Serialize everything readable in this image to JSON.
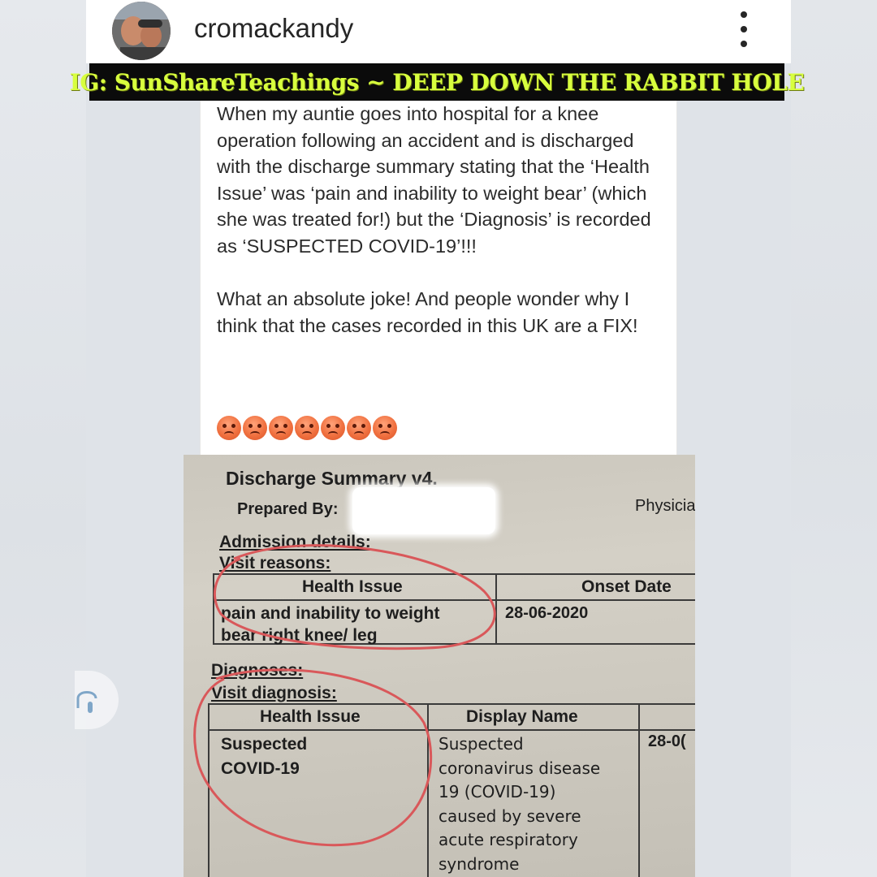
{
  "header": {
    "username": "cromackandy"
  },
  "banner": {
    "text": "IG: SunShareTeachings ~ DEEP DOWN THE RABBIT HOLE"
  },
  "post": {
    "paragraph1": "When my auntie goes into hospital for a knee operation following an accident and is discharged with the discharge summary stating that the ‘Health Issue’ was ‘pain and inability to weight bear’ (which she was treated for!) but the ‘Diagnosis’ is recorded as ‘SUSPECTED COVID-19’!!!",
    "paragraph2": "What an absolute joke! And people wonder why I think that the cases recorded in this UK are a FIX!",
    "emoji_icon": "angry-face-icon",
    "emoji_count": 7
  },
  "document": {
    "title": "Discharge Summary v4.",
    "prepared_by_label": "Prepared By:",
    "physician_label": "Physicia",
    "admission_heading": "Admission details:",
    "visit_reasons_heading": "Visit reasons:",
    "reasons_table": {
      "headers": [
        "Health Issue",
        "Onset Date"
      ],
      "health_issue": "pain and inability to weight\nbear right knee/ leg",
      "onset_date": "28-06-2020"
    },
    "diagnoses_heading": "Diagnoses:",
    "visit_diagnosis_heading": "Visit diagnosis:",
    "diagnosis_table": {
      "headers": [
        "Health Issue",
        "Display Name"
      ],
      "health_issue": "Suspected\nCOVID-19",
      "display_name": "Suspected\ncoronavirus disease\n19 (COVID-19)\ncaused by severe\nacute respiratory\nsyndrome",
      "date": "28-0("
    }
  },
  "colors": {
    "banner_text": "#d8ff3e",
    "banner_bg": "#0b0b0b",
    "annotation_circle": "#d9585a"
  }
}
